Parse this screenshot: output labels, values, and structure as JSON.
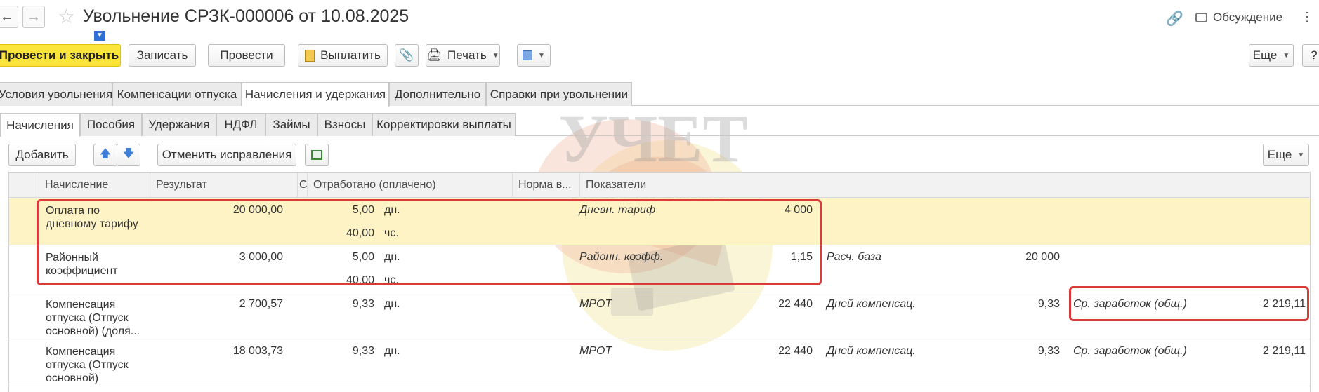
{
  "window": {
    "title": "Увольнение СРЗК-000006 от 10.08.2025",
    "discuss_label": "Обсуждение"
  },
  "toolbar": {
    "post_close": "Провести и закрыть",
    "save": "Записать",
    "post": "Провести",
    "pay": "Выплатить",
    "print": "Печать",
    "more": "Еще",
    "help": "?"
  },
  "tabs_main": [
    {
      "label": "Условия увольнения",
      "active": false
    },
    {
      "label": "Компенсации отпуска",
      "active": false
    },
    {
      "label": "Начисления и удержания",
      "active": true
    },
    {
      "label": "Дополнительно",
      "active": false
    },
    {
      "label": "Справки при увольнении",
      "active": false
    }
  ],
  "tabs_sub": [
    {
      "label": "Начисления",
      "active": true
    },
    {
      "label": "Пособия",
      "active": false
    },
    {
      "label": "Удержания",
      "active": false
    },
    {
      "label": "НДФЛ",
      "active": false
    },
    {
      "label": "Займы",
      "active": false
    },
    {
      "label": "Взносы",
      "active": false
    },
    {
      "label": "Корректировки выплаты",
      "active": false
    }
  ],
  "grid_toolbar": {
    "add": "Добавить",
    "cancel_fix": "Отменить исправления",
    "more": "Еще"
  },
  "table": {
    "headers": {
      "accrual": "Начисление",
      "result": "Результат",
      "c": "С",
      "worked": "Отработано (оплачено)",
      "norm": "Норма в...",
      "indicators": "Показатели"
    },
    "rows": [
      {
        "name": "Оплата по дневному тарифу",
        "result": "20 000,00",
        "days": "5,00",
        "days_unit": "дн.",
        "hours": "40,00",
        "hours_unit": "чс.",
        "ind1_name": "Дневн. тариф",
        "ind1_val": "4 000",
        "ind2_name": "",
        "ind2_val": "",
        "ind3_name": "",
        "ind3_val": "",
        "selected": true
      },
      {
        "name": "Районный коэффициент",
        "result": "3 000,00",
        "days": "5,00",
        "days_unit": "дн.",
        "hours": "40,00",
        "hours_unit": "чс.",
        "ind1_name": "Районн. коэфф.",
        "ind1_val": "1,15",
        "ind2_name": "Расч. база",
        "ind2_val": "20 000",
        "ind3_name": "",
        "ind3_val": "",
        "selected": false
      },
      {
        "name": "Компенсация отпуска (Отпуск основной) (доля...",
        "result": "2 700,57",
        "days": "9,33",
        "days_unit": "дн.",
        "hours": "",
        "hours_unit": "",
        "ind1_name": "МРОТ",
        "ind1_val": "22 440",
        "ind2_name": "Дней компенсац.",
        "ind2_val": "9,33",
        "ind3_name": "Ср. заработок (общ.)",
        "ind3_val": "2 219,11",
        "selected": false
      },
      {
        "name": "Компенсация отпуска (Отпуск основной)",
        "result": "18 003,73",
        "days": "9,33",
        "days_unit": "дн.",
        "hours": "",
        "hours_unit": "",
        "ind1_name": "МРОТ",
        "ind1_val": "22 440",
        "ind2_name": "Дней компенсац.",
        "ind2_val": "9,33",
        "ind3_name": "Ср. заработок (общ.)",
        "ind3_val": "2 219,11",
        "selected": false
      }
    ]
  },
  "watermark": {
    "line1": "УЧЕТ",
    "line2": "БЕЗ ЗАБОТ"
  },
  "icons": {
    "back": "arrow-left-icon",
    "forward": "arrow-right-icon",
    "favorite": "star-icon",
    "link": "link-icon",
    "discuss": "chat-icon",
    "pay": "document-icon",
    "attach": "paperclip-icon",
    "print": "printer-icon",
    "move_up": "arrow-up-icon",
    "move_down": "arrow-down-icon",
    "table_settings": "table-add-icon"
  },
  "colors": {
    "primary_button": "#fce53b",
    "selected_row": "#fdf3c4",
    "highlight_frame": "#d93a3a",
    "accent_blue": "#3f7ed8"
  }
}
